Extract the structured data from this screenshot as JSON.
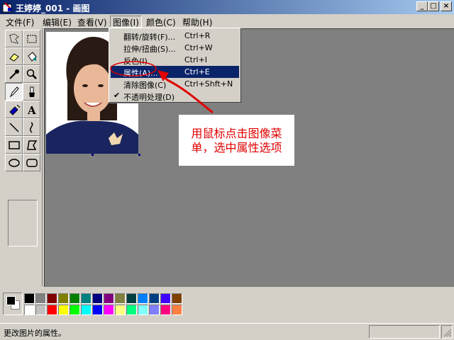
{
  "window": {
    "title": "王婷婷_001 - 画图"
  },
  "menubar": {
    "items": [
      {
        "label": "文件(F)"
      },
      {
        "label": "编辑(E)"
      },
      {
        "label": "查看(V)"
      },
      {
        "label": "图像(I)"
      },
      {
        "label": "颜色(C)"
      },
      {
        "label": "帮助(H)"
      }
    ]
  },
  "image_menu": {
    "items": [
      {
        "label": "翻转/旋转(F)...",
        "shortcut": "Ctrl+R"
      },
      {
        "label": "拉伸/扭曲(S)...",
        "shortcut": "Ctrl+W"
      },
      {
        "label": "反色(I)",
        "shortcut": "Ctrl+I"
      },
      {
        "label": "属性(A)...",
        "shortcut": "Ctrl+E",
        "selected": true
      },
      {
        "label": "清除图像(C)",
        "shortcut": "Ctrl+Shft+N"
      },
      {
        "label": "不透明处理(D)",
        "shortcut": "",
        "checked": true
      }
    ]
  },
  "annotation": {
    "line1": "用鼠标点击图像菜",
    "line2": "单，选中属性选项"
  },
  "tools": [
    "free-select",
    "rect-select",
    "eraser",
    "fill",
    "color-picker",
    "magnifier",
    "pencil",
    "brush",
    "airbrush",
    "text",
    "line",
    "curve",
    "rectangle",
    "polygon",
    "ellipse",
    "rounded-rect"
  ],
  "palette": {
    "row1": [
      "#000000",
      "#808080",
      "#800000",
      "#808000",
      "#008000",
      "#008080",
      "#000080",
      "#800080",
      "#808040",
      "#004040",
      "#0080ff",
      "#004080",
      "#4000ff",
      "#804000"
    ],
    "row2": [
      "#ffffff",
      "#c0c0c0",
      "#ff0000",
      "#ffff00",
      "#00ff00",
      "#00ffff",
      "#0000ff",
      "#ff00ff",
      "#ffff80",
      "#00ff80",
      "#80ffff",
      "#8080ff",
      "#ff0080",
      "#ff8040"
    ]
  },
  "statusbar": {
    "text": "更改图片的属性。"
  },
  "colors": {
    "titlebar": "#0a246a",
    "highlight": "#0a246a",
    "annotation": "#e00000",
    "workspace": "#808080"
  }
}
